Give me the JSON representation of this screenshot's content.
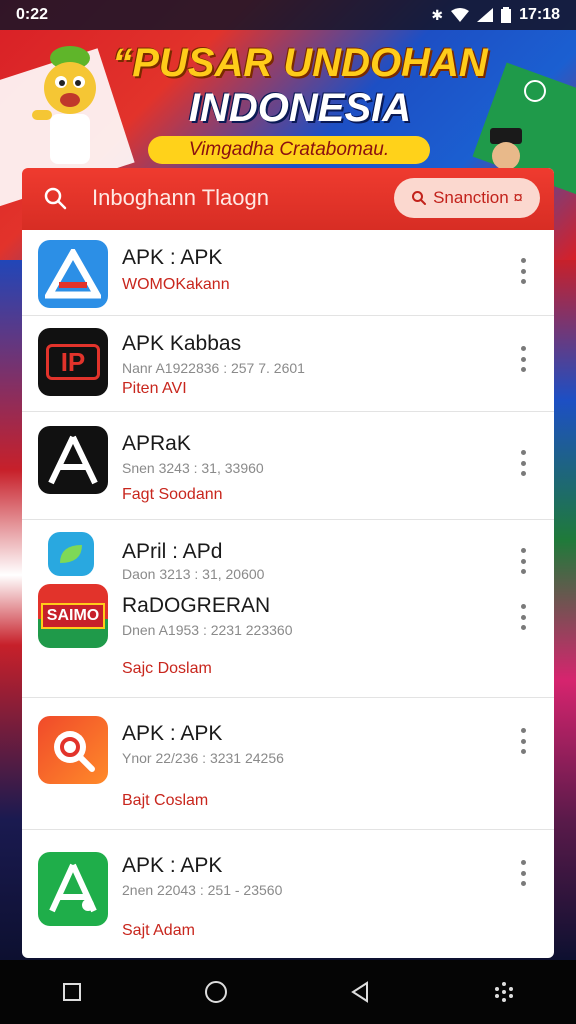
{
  "status_bar": {
    "time_left": "0:22",
    "time_right": "17:18",
    "icons": [
      "bluetooth-icon",
      "wifi-icon",
      "signal-icon",
      "battery-icon"
    ]
  },
  "banner": {
    "title_line1": "“PUSAR UNDOHAN",
    "title_line2": "INDONESIA",
    "subtitle": "Vimgadha Cratabomau."
  },
  "search": {
    "text": "Inboghann Tlaogn",
    "button_label": "Snanction ¤"
  },
  "apps": [
    {
      "name": "APK : APK",
      "meta": "",
      "tag": "WOMOKakann",
      "icon": "apk-blue-a-icon"
    },
    {
      "name": "APK Kabbas",
      "meta": "Nanr A1922836 : 257 7. 2601",
      "tag": "Piten AVI",
      "icon": "ip-red-icon"
    },
    {
      "name": "APRaK",
      "meta": "Snen 3243 : 31, 33960",
      "tag": "Fagt Soodann",
      "icon": "apk-black-a-icon"
    },
    {
      "name": "APril : APd",
      "meta": "Daon 3213 : 31, 20600",
      "tag": "",
      "icon": "green-leaf-icon"
    },
    {
      "name": "RaDOGRERAN",
      "meta": "Dnen A1953 : 2231 223360",
      "tag": "Sajc Doslam",
      "icon": "saimo-icon"
    },
    {
      "name": "APK : APK",
      "meta": "Ynor 22/236 : 3231 24256",
      "tag": "Bajt Coslam",
      "icon": "orange-search-icon"
    },
    {
      "name": "APK : APK",
      "meta": "2nen 22043 : 251 - 23560",
      "tag": "Sajt Adam",
      "icon": "green-a-icon"
    }
  ],
  "colors": {
    "accent_red": "#d72d24",
    "banner_yellow": "#ffcc1a",
    "tag_red": "#c8261d"
  }
}
